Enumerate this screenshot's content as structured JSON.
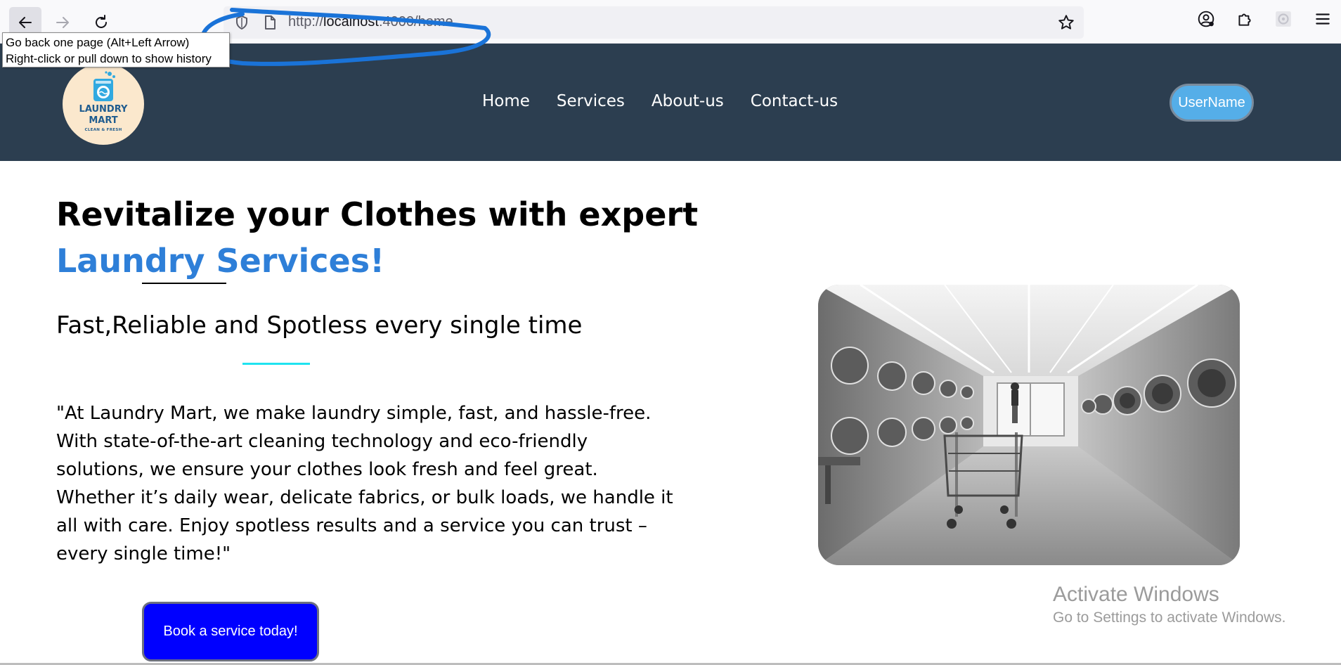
{
  "browser": {
    "back_icon": "arrow-left-icon",
    "forward_icon": "arrow-right-icon",
    "reload_icon": "reload-icon",
    "url_prefix": "http://",
    "url_host": "localhost",
    "url_rest": ":4000/home",
    "tooltip_line1": "Go back one page (Alt+Left Arrow)",
    "tooltip_line2": "Right-click or pull down to show history",
    "annotation_color": "#1a73d8"
  },
  "header": {
    "logo_line1": "LAUNDRY",
    "logo_line2": "MART",
    "logo_line3": "CLEAN & FRESH",
    "nav": [
      "Home",
      "Services",
      "About-us",
      "Contact-us"
    ],
    "user_button": "UserName",
    "background_color": "#2c3e50"
  },
  "hero": {
    "headline_part1": "Revitalize your Clothes with expert",
    "headline_part2": "Laundry Services!",
    "subtitle": "Fast,Reliable and Spotless every single time",
    "paragraph_lines": [
      "\"At Laundry Mart, we make laundry simple, fast, and hassle-free.",
      "With state-of-the-art cleaning technology and eco-friendly",
      "solutions, we ensure your clothes look fresh and feel great.",
      "Whether it’s daily wear, delicate fabrics, or bulk loads, we handle it",
      "all with care. Enjoy spotless results and a service you can trust –",
      "every single time!\""
    ],
    "cta_label": "Book a service today!",
    "accent_color": "#2e7fd8",
    "cta_color": "#0000ff"
  },
  "watermark": {
    "line1": "Activate Windows",
    "line2": "Go to Settings to activate Windows."
  }
}
